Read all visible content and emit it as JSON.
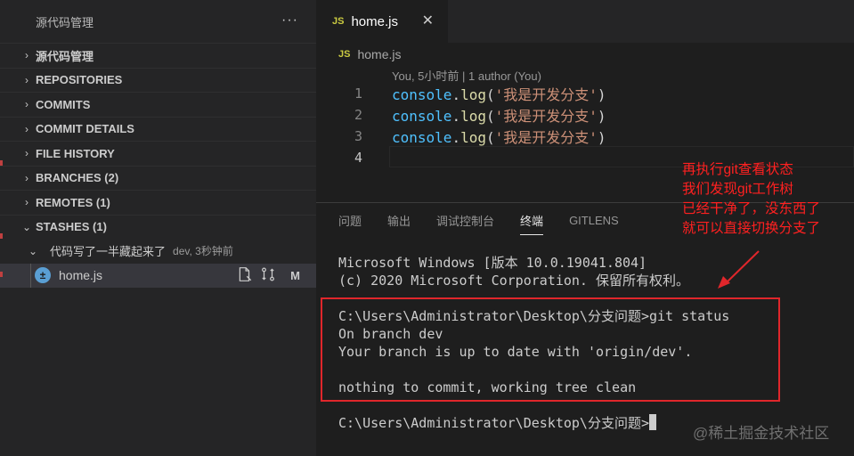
{
  "sidebar": {
    "title": "源代码管理",
    "more": "···",
    "sections": [
      {
        "label": "源代码管理",
        "chevron": "›"
      },
      {
        "label": "REPOSITORIES",
        "chevron": "›"
      },
      {
        "label": "COMMITS",
        "chevron": "›"
      },
      {
        "label": "COMMIT DETAILS",
        "chevron": "›"
      },
      {
        "label": "FILE HISTORY",
        "chevron": "›"
      },
      {
        "label": "BRANCHES (2)",
        "chevron": "›"
      },
      {
        "label": "REMOTES (1)",
        "chevron": "›"
      },
      {
        "label": "STASHES (1)",
        "chevron": "⌄"
      }
    ],
    "stash": {
      "label": "代码写了一半藏起来了",
      "desc": "dev, 3秒钟前",
      "chevron": "⌄"
    },
    "file": {
      "name": "home.js",
      "status": "M",
      "icon": "stash-file-icon"
    }
  },
  "editor": {
    "tab": {
      "icon": "JS",
      "label": "home.js",
      "close": "✕"
    },
    "breadcrumb": {
      "icon": "JS",
      "label": "home.js"
    },
    "codelens": "You, 5小时前 | 1 author (You)",
    "lines": [
      {
        "num": "1",
        "obj": "console",
        "fn": "log",
        "str": "'我是开发分支'"
      },
      {
        "num": "2",
        "obj": "console",
        "fn": "log",
        "str": "'我是开发分支'"
      },
      {
        "num": "3",
        "obj": "console",
        "fn": "log",
        "str": "'我是开发分支'"
      },
      {
        "num": "4",
        "obj": "",
        "fn": "",
        "str": ""
      }
    ]
  },
  "panel": {
    "tabs": [
      "问题",
      "输出",
      "调试控制台",
      "终端",
      "GITLENS"
    ],
    "active_tab": "终端",
    "terminal": [
      "Microsoft Windows [版本 10.0.19041.804]",
      "(c) 2020 Microsoft Corporation. 保留所有权利。",
      "",
      "C:\\Users\\Administrator\\Desktop\\分支问题>git status",
      "On branch dev",
      "Your branch is up to date with 'origin/dev'.",
      "",
      "nothing to commit, working tree clean",
      "",
      "C:\\Users\\Administrator\\Desktop\\分支问题>"
    ]
  },
  "annotation": {
    "lines": [
      "再执行git查看状态",
      "我们发现git工作树",
      "已经干净了，没东西了",
      "就可以直接切换分支了"
    ],
    "color": "#ff2020"
  },
  "watermark": "@稀土掘金技术社区"
}
